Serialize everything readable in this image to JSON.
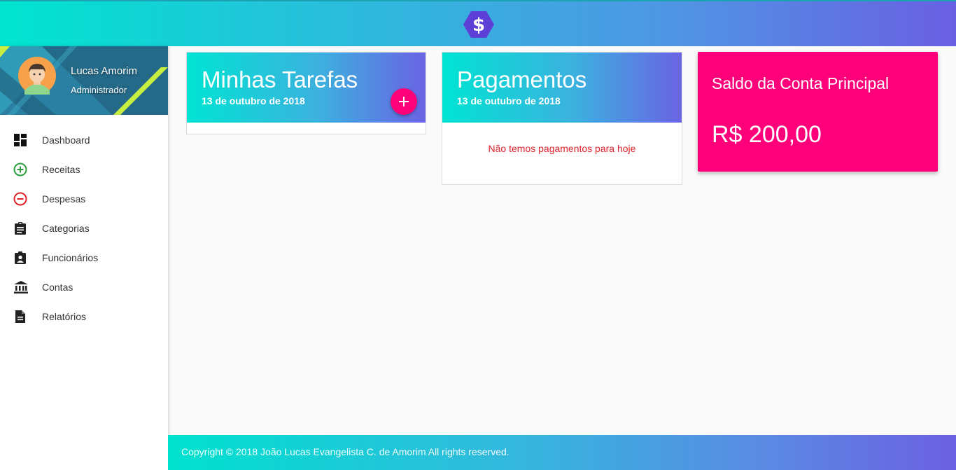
{
  "header": {
    "logo_icon": "dollar-hexagon-icon",
    "logo_color": "#5b3fd6"
  },
  "sidebar": {
    "profile": {
      "name": "Lucas Amorim",
      "role": "Administrador",
      "avatar_icon": "user-avatar-icon"
    },
    "items": [
      {
        "label": "Dashboard",
        "icon": "dashboard-icon"
      },
      {
        "label": "Receitas",
        "icon": "plus-circle-icon"
      },
      {
        "label": "Despesas",
        "icon": "minus-circle-icon"
      },
      {
        "label": "Categorias",
        "icon": "clipboard-icon"
      },
      {
        "label": "Funcionários",
        "icon": "badge-icon"
      },
      {
        "label": "Contas",
        "icon": "bank-icon"
      },
      {
        "label": "Relatórios",
        "icon": "document-icon"
      }
    ]
  },
  "main": {
    "tasks_card": {
      "title": "Minhas Tarefas",
      "date": "13 de outubro de 2018",
      "add_icon": "plus-icon"
    },
    "payments_card": {
      "title": "Pagamentos",
      "date": "13 de outubro de 2018",
      "empty_message": "Não temos pagamentos para hoje"
    },
    "balance_card": {
      "title": "Saldo da Conta Principal",
      "value": "R$ 200,00"
    }
  },
  "footer": {
    "copyright": "Copyright © 2018 João Lucas Evangelista C. de Amorim All rights reserved."
  },
  "colors": {
    "accent_pink": "#ff007b",
    "gradient_start": "#00e5d0",
    "gradient_end": "#6a5fe2",
    "receitas_green": "#2e9e3f",
    "despesas_red": "#e0202b",
    "error_text": "#e0202b"
  }
}
